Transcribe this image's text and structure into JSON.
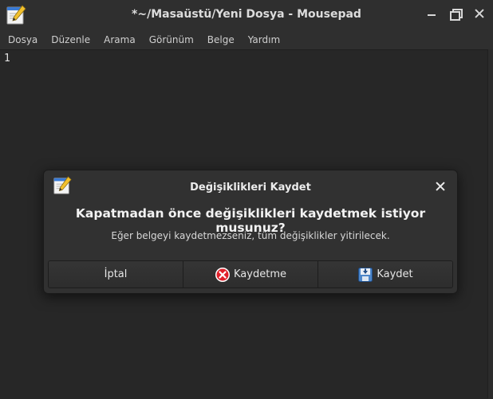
{
  "window": {
    "title": "*~/Masaüstü/Yeni Dosya - Mousepad",
    "icon": "text-editor-icon"
  },
  "menu": [
    "Dosya",
    "Düzenle",
    "Arama",
    "Görünüm",
    "Belge",
    "Yardım"
  ],
  "editor": {
    "line_numbers": [
      "1"
    ]
  },
  "dialog": {
    "title": "Değişiklikleri Kaydet",
    "heading": "Kapatmadan önce değişiklikleri kaydetmek istiyor musunuz?",
    "message": "Eğer belgeyi kaydetmezseniz, tüm değişiklikler yitirilecek.",
    "buttons": {
      "cancel": "İptal",
      "dont_save": "Kaydetme",
      "save": "Kaydet"
    }
  }
}
